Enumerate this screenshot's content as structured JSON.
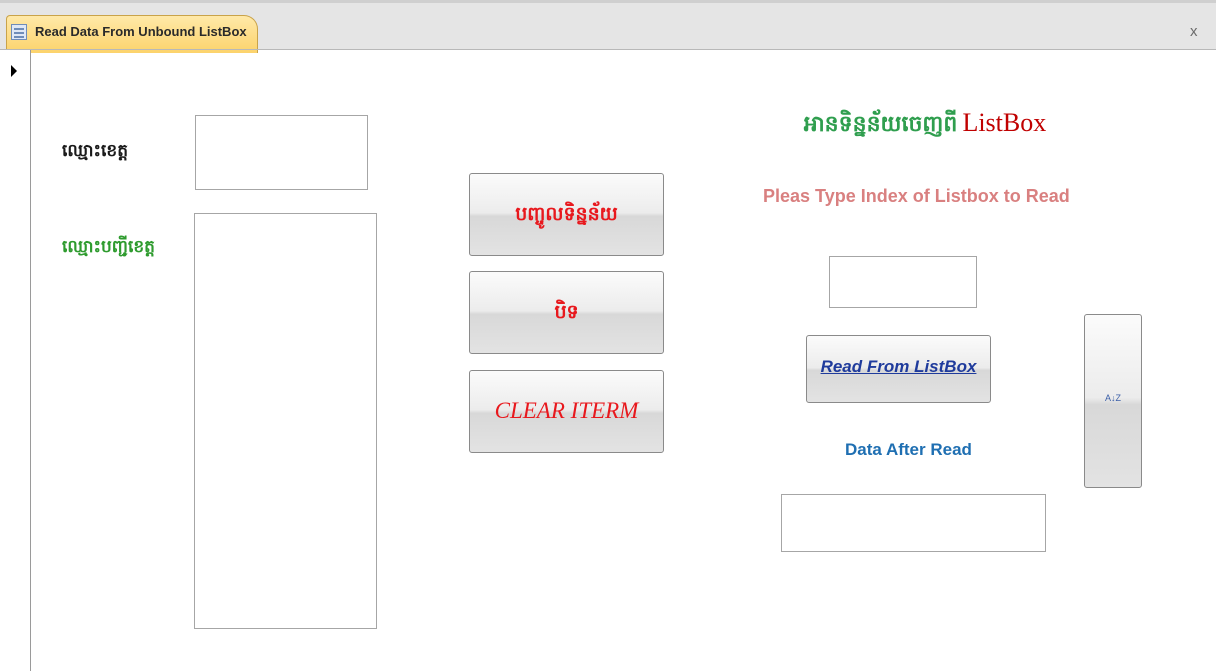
{
  "window": {
    "tab_title": "Read Data From Unbound ListBox",
    "close_glyph": "x"
  },
  "icons": {
    "tab_icon": "form-icon",
    "record_selector": "triangle-right-icon",
    "sort_icon": "sort-az-icon"
  },
  "form": {
    "labels": {
      "province_name": "ឈ្មោះខេត្ត",
      "province_list": "ឈ្មោះបញ្ជីខេត្ត",
      "heading_khmer": "អានទិន្នន័យចេញពី",
      "heading_latin": "ListBox",
      "prompt": "Pleas Type Index of Listbox to Read",
      "result": "Data After Read"
    },
    "buttons": {
      "add_data": "បញ្ចូលទិន្នន័យ",
      "close": "បិទ",
      "clear": "CLEAR ITERM",
      "read": "Read From ListBox",
      "sort_glyph": "A↓Z"
    },
    "fields": {
      "province_name": "",
      "index": "",
      "result": ""
    },
    "list_items": []
  },
  "colors": {
    "tab_active": "#fcd36c",
    "label_black": "#1a1a1a",
    "label_green": "#2e9b2e",
    "heading_green": "#2f9e4e",
    "heading_red": "#c00000",
    "prompt": "#d98080",
    "result_label": "#1f6fb2",
    "button_red": "#e8181d",
    "button_link": "#1f3b9c"
  }
}
